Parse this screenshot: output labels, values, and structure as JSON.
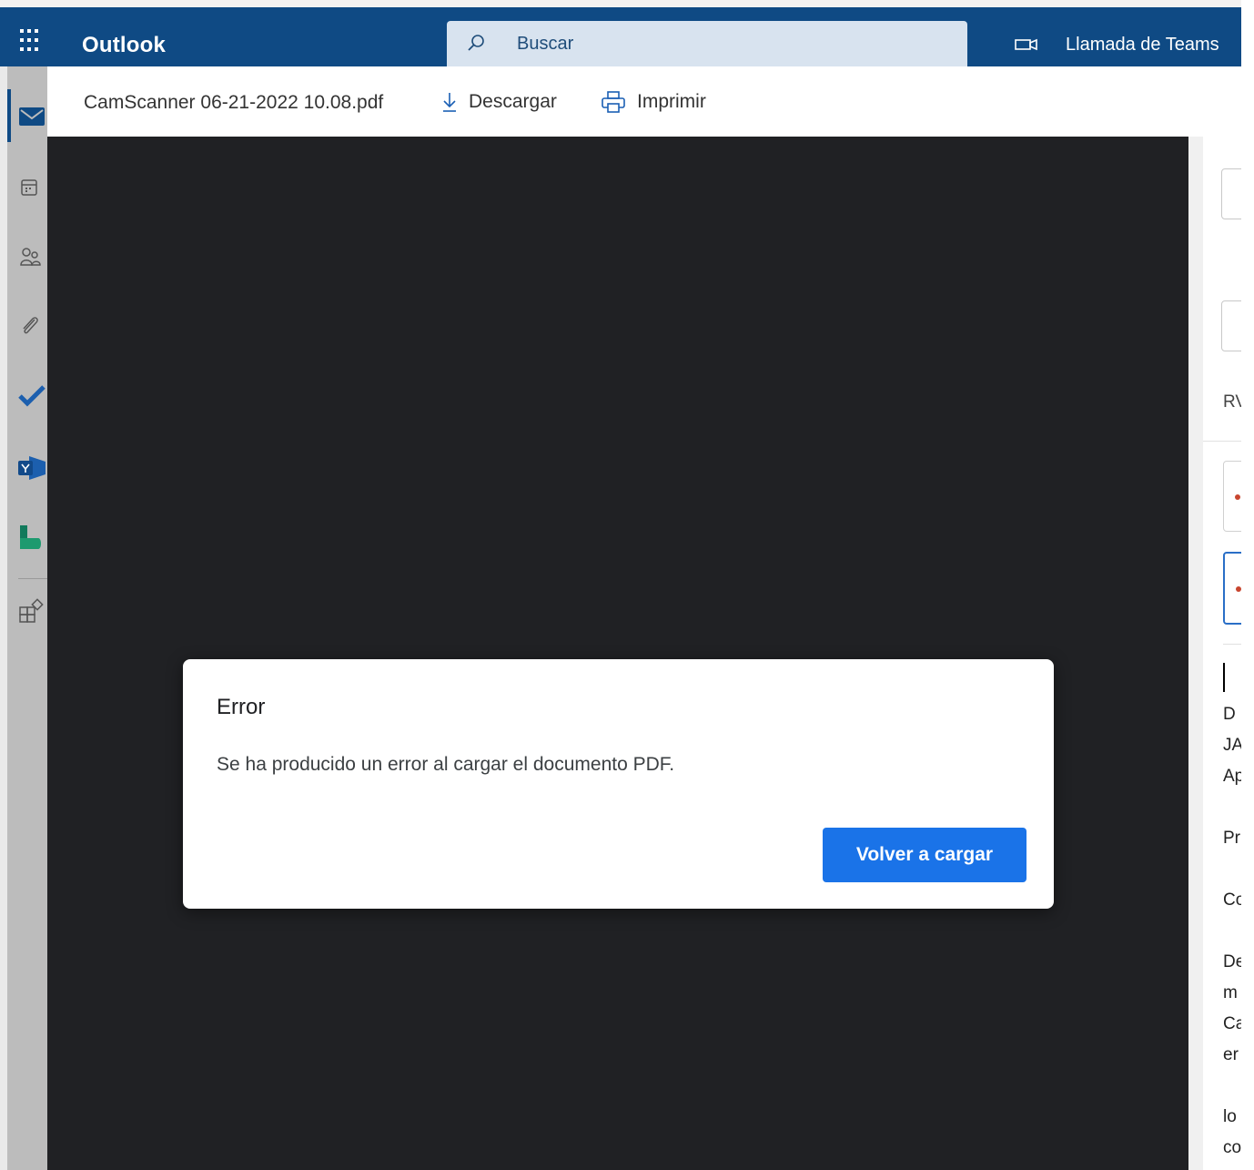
{
  "topbar": {
    "app_name": "Outlook",
    "search_placeholder": "Buscar",
    "teams_call_label": "Llamada de Teams",
    "icons": [
      "app-launcher-icon",
      "search-icon",
      "video-camera-icon"
    ]
  },
  "left_rail": {
    "items": [
      {
        "name": "mail",
        "icon": "mail-icon",
        "active": true
      },
      {
        "name": "calendar",
        "icon": "calendar-icon"
      },
      {
        "name": "people",
        "icon": "people-icon"
      },
      {
        "name": "files",
        "icon": "paperclip-icon"
      },
      {
        "name": "to-do",
        "icon": "checkmark-icon"
      },
      {
        "name": "yammer",
        "icon": "yammer-icon"
      },
      {
        "name": "bookings",
        "icon": "bookings-icon"
      },
      {
        "name": "apps",
        "icon": "apps-icon"
      }
    ]
  },
  "file_viewer": {
    "file_name": "CamScanner 06-21-2022 10.08.pdf",
    "download_label": "Descargar",
    "print_label": "Imprimir"
  },
  "error_dialog": {
    "title": "Error",
    "message": "Se ha producido un error al cargar el documento PDF.",
    "reload_label": "Volver a cargar"
  },
  "reading_pane_partial": {
    "subject_fragment": "RV",
    "body_fragments": [
      "D",
      "JA",
      "Ap",
      "",
      "Pr",
      "",
      "Co",
      "",
      "De",
      "m",
      "Ca",
      "er",
      "",
      "lo",
      "co"
    ]
  },
  "colors": {
    "header_blue": "#0f4a84",
    "viewer_bg": "#202124",
    "button_blue": "#1a73e8"
  }
}
